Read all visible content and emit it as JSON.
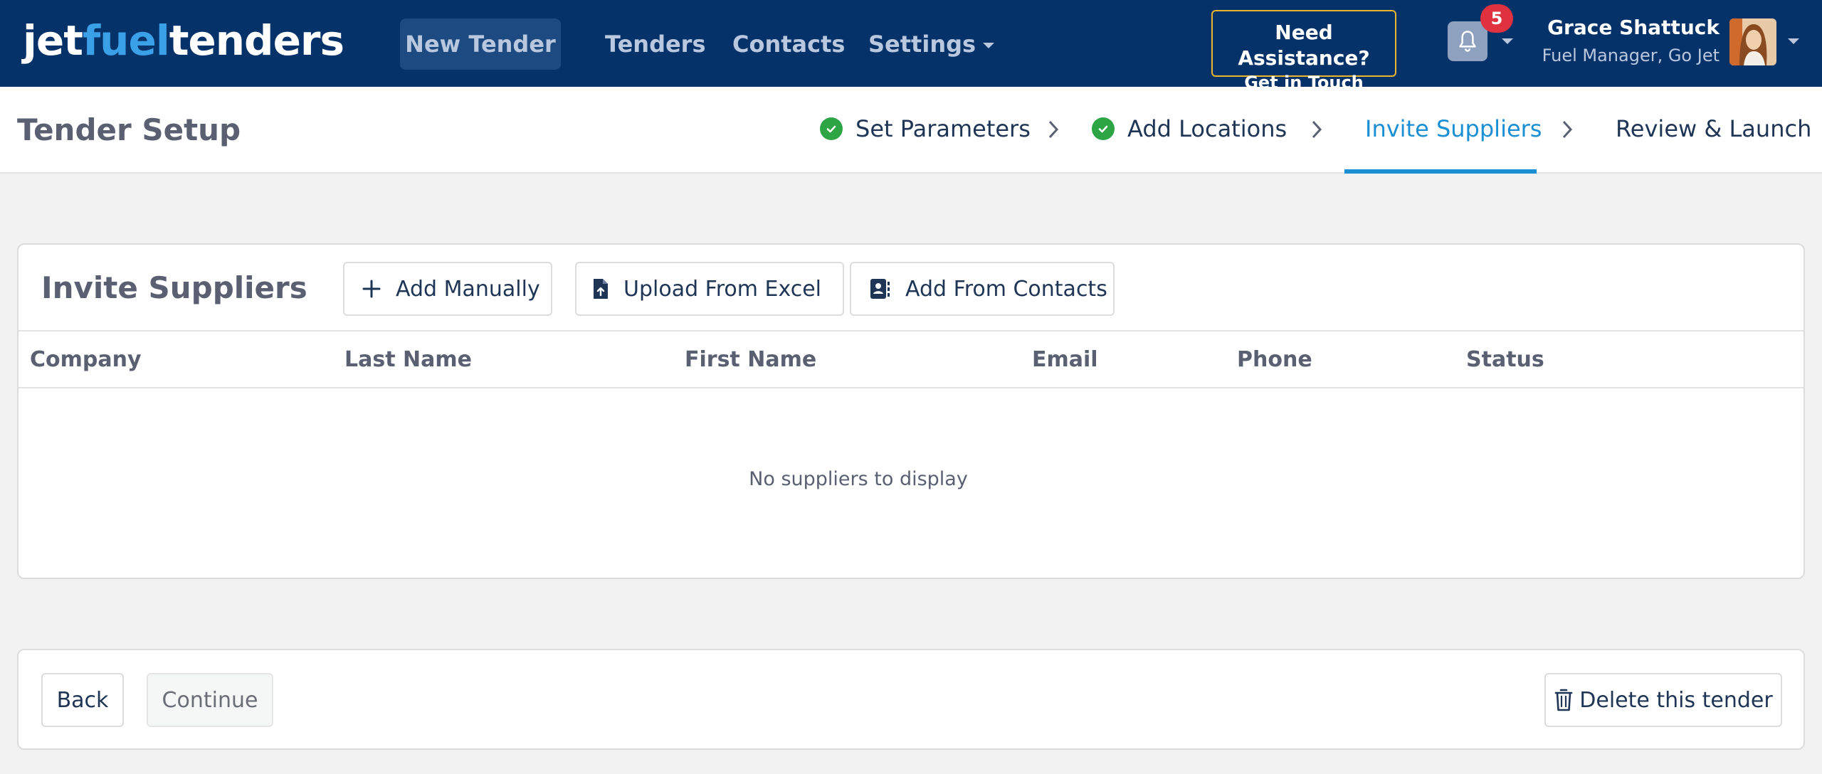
{
  "brand": {
    "logo_part1": "jet",
    "logo_part2": "fuel",
    "logo_part3": "tenders"
  },
  "nav": {
    "new_tender": "New Tender",
    "tenders": "Tenders",
    "contacts": "Contacts",
    "settings": "Settings"
  },
  "assistance": {
    "line1": "Need Assistance?",
    "line2": "Get in Touch"
  },
  "notifications": {
    "count": "5",
    "icon": "bell-icon"
  },
  "user": {
    "name": "Grace Shattuck",
    "role": "Fuel Manager, Go Jet"
  },
  "page": {
    "title": "Tender Setup"
  },
  "steps": [
    {
      "label": "Set Parameters",
      "status": "complete"
    },
    {
      "label": "Add Locations",
      "status": "complete"
    },
    {
      "label": "Invite Suppliers",
      "status": "active"
    },
    {
      "label": "Review & Launch",
      "status": "pending"
    }
  ],
  "invite": {
    "title": "Invite Suppliers",
    "buttons": {
      "add_manually": "Add Manually",
      "upload_excel": "Upload From Excel",
      "add_contacts": "Add From Contacts"
    },
    "columns": [
      "Company",
      "Last Name",
      "First Name",
      "Email",
      "Phone",
      "Status"
    ],
    "empty_message": "No suppliers to display"
  },
  "footer": {
    "back": "Back",
    "continue": "Continue",
    "delete": "Delete this tender"
  },
  "colors": {
    "nav_bg": "#06326a",
    "accent": "#1a8fd4",
    "success": "#2ea545",
    "badge": "#e0323e",
    "assist_border": "#e9b62f"
  }
}
